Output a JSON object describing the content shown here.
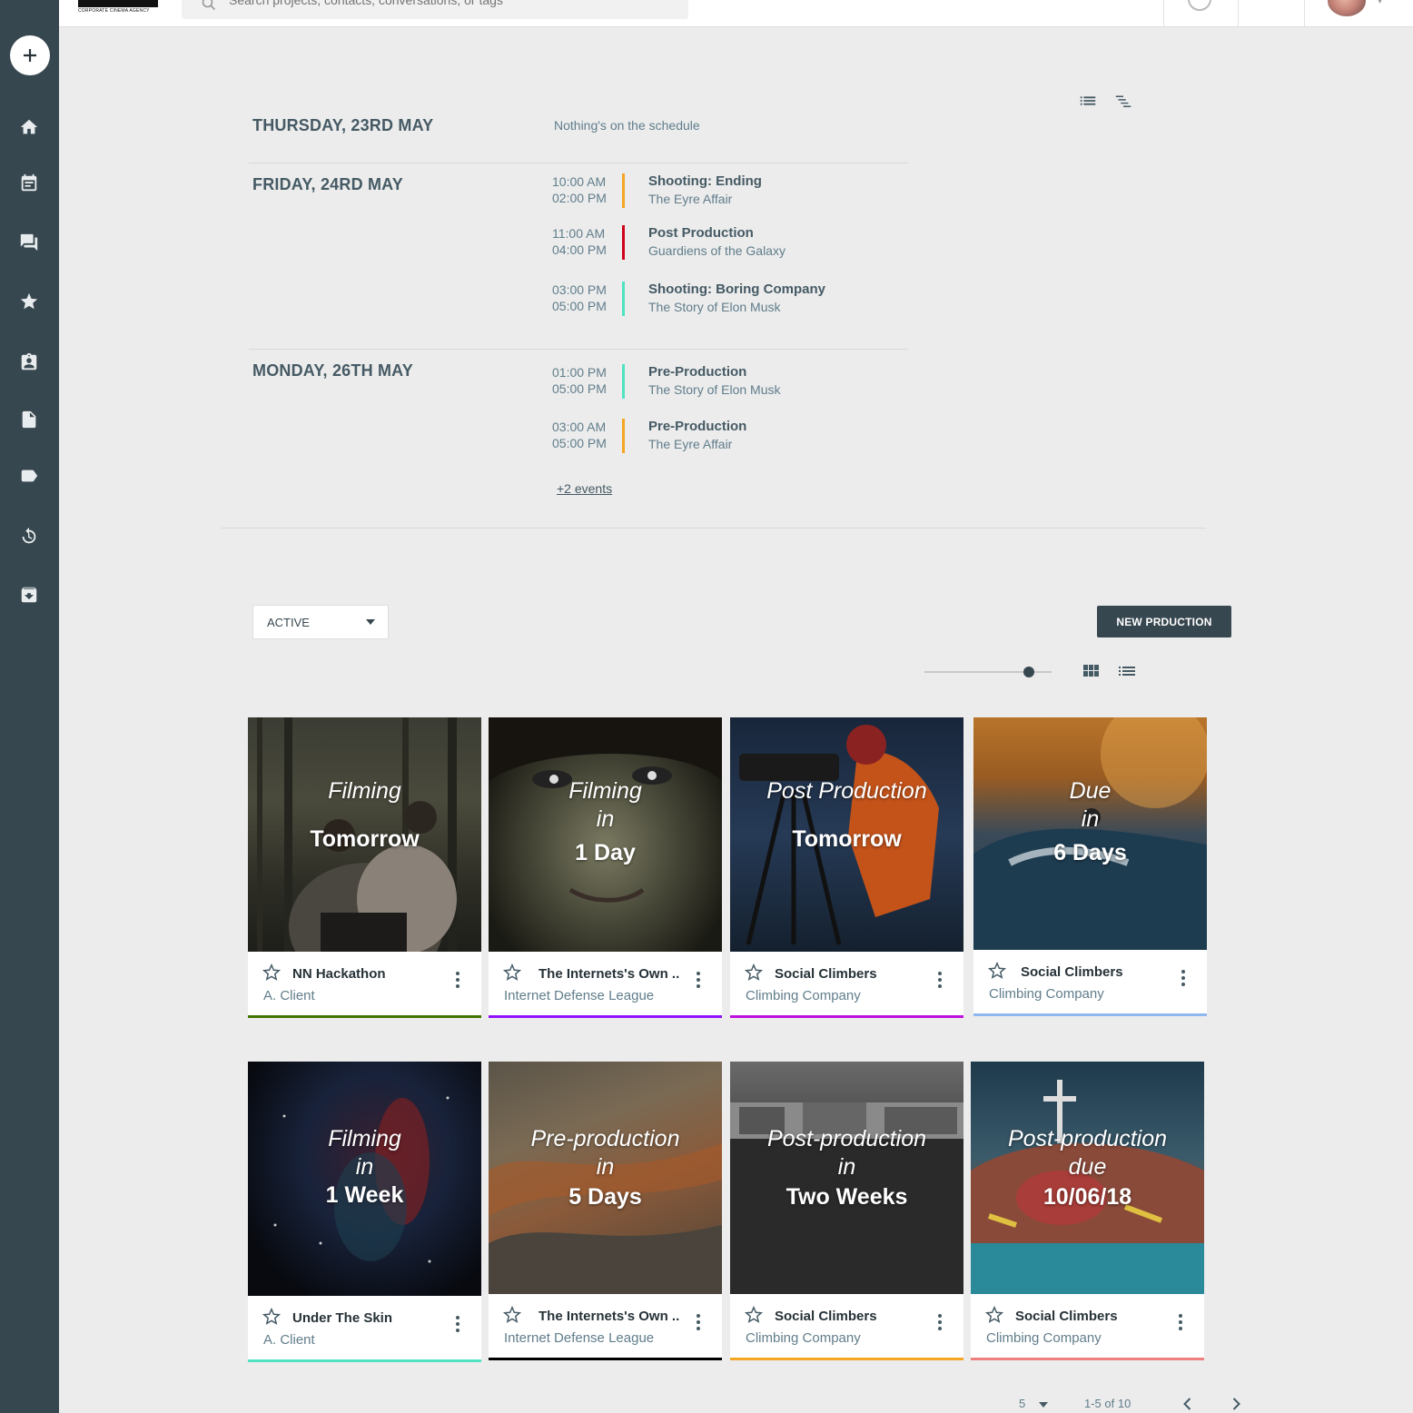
{
  "topbar": {
    "logo_text": "CORPORATE CINEMA AGENCY",
    "search_placeholder": "Search projects, contacts, conversations, or tags"
  },
  "sidebar": {
    "items": [
      "add",
      "home",
      "calendar",
      "chat",
      "favorites",
      "contacts",
      "documents",
      "tags",
      "history",
      "archive"
    ]
  },
  "schedule": {
    "days": [
      {
        "label": "THURSDAY, 23RD MAY",
        "empty_text": "Nothing's on the schedule"
      },
      {
        "label": "FRIDAY, 24RD MAY"
      },
      {
        "label": "MONDAY, 26TH MAY"
      }
    ],
    "events": [
      {
        "start": "10:00 AM",
        "end": "02:00 PM",
        "title": "Shooting: Ending",
        "project": "The Eyre Affair",
        "color": "#f5a623"
      },
      {
        "start": "11:00 AM",
        "end": "04:00 PM",
        "title": "Post Production",
        "project": "Guardiens of the Galaxy",
        "color": "#d0021b"
      },
      {
        "start": "03:00 PM",
        "end": "05:00 PM",
        "title": "Shooting: Boring Company",
        "project": "The Story of Elon Musk",
        "color": "#50e3c2"
      },
      {
        "start": "01:00 PM",
        "end": "05:00 PM",
        "title": "Pre-Production",
        "project": "The Story of Elon Musk",
        "color": "#50e3c2"
      },
      {
        "start": "03:00 AM",
        "end": "05:00 PM",
        "title": "Pre-Production",
        "project": "The Eyre Affair",
        "color": "#f5a623"
      }
    ],
    "more_events": "+2 events"
  },
  "controls": {
    "filter_value": "ACTIVE",
    "new_button": "NEW PRDUCTION",
    "size_slider_level": 0.85
  },
  "cards": [
    {
      "status": "Filming",
      "mid": "",
      "when": "Tomorrow",
      "title": "NN Hackathon",
      "client": "A. Client",
      "accent": "#417505"
    },
    {
      "status": "Filming",
      "mid": "in",
      "when": "1 Day",
      "title": "The Internets's Own ..",
      "client": "Internet Defense League",
      "accent": "#9013fe"
    },
    {
      "status": "Post Production",
      "mid": "",
      "when": "Tomorrow",
      "title": "Social Climbers",
      "client": "Climbing Company",
      "accent": "#bd10e0"
    },
    {
      "status": "Due",
      "mid": "in",
      "when": "6 Days",
      "title": "Social Climbers",
      "client": "Climbing Company",
      "accent": "#90b8f0"
    },
    {
      "status": "Filming",
      "mid": "in",
      "when": "1 Week",
      "title": "Under The Skin",
      "client": "A. Client",
      "accent": "#50e3c2"
    },
    {
      "status": "Pre-production",
      "mid": "in",
      "when": "5 Days",
      "title": "The Internets's Own ..",
      "client": "Internet Defense League",
      "accent": "#000000"
    },
    {
      "status": "Post-production",
      "mid": "in",
      "when": "Two Weeks",
      "title": "Social Climbers",
      "client": "Climbing Company",
      "accent": "#f5a623"
    },
    {
      "status": "Post-production",
      "mid": "due",
      "when": "10/06/18",
      "title": "Social Climbers",
      "client": "Climbing Company",
      "accent": "#f08080"
    }
  ],
  "pagination": {
    "per_page": "5",
    "range": "1-5 of 10"
  }
}
